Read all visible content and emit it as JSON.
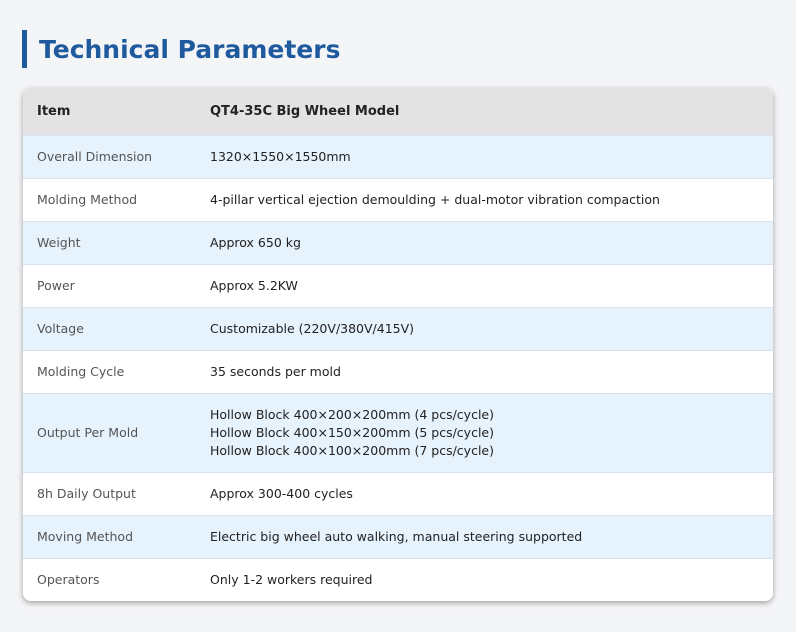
{
  "page": {
    "title": "Technical Parameters"
  },
  "table": {
    "headers": [
      "Item",
      "QT4-35C Big Wheel Model"
    ],
    "rows": [
      {
        "item": "Overall Dimension",
        "value": [
          "1320×1550×1550mm"
        ]
      },
      {
        "item": "Molding Method",
        "value": [
          "4-pillar vertical ejection demoulding + dual-motor vibration compaction"
        ]
      },
      {
        "item": "Weight",
        "value": [
          "Approx 650 kg"
        ]
      },
      {
        "item": "Power",
        "value": [
          "Approx 5.2KW"
        ]
      },
      {
        "item": "Voltage",
        "value": [
          "Customizable (220V/380V/415V)"
        ]
      },
      {
        "item": "Molding Cycle",
        "value": [
          "35 seconds per mold"
        ]
      },
      {
        "item": "Output Per Mold",
        "value": [
          "Hollow Block 400×200×200mm (4 pcs/cycle)",
          "Hollow Block 400×150×200mm (5 pcs/cycle)",
          "Hollow Block 400×100×200mm (7 pcs/cycle)"
        ]
      },
      {
        "item": "8h Daily Output",
        "value": [
          "Approx 300-400 cycles"
        ]
      },
      {
        "item": "Moving Method",
        "value": [
          "Electric big wheel auto walking, manual steering supported"
        ]
      },
      {
        "item": "Operators",
        "value": [
          "Only 1-2 workers required"
        ]
      }
    ]
  },
  "colors": {
    "accent": "#1f5a9e",
    "header_bg": "#e3e3e3",
    "stripe_bg": "#e6f2fc"
  }
}
